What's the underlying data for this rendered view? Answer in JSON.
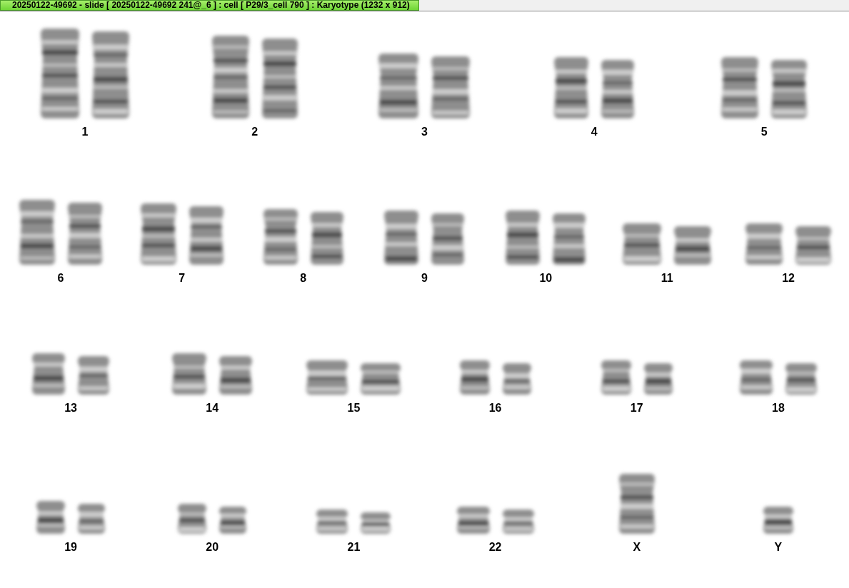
{
  "title_bar": {
    "title": "20250122-49692 - slide [ 20250122-49692 241@_6 ] : cell [ P29/3_cell 790 ] : Karyotype  (1232 x 912)"
  },
  "karyotype": {
    "rows": [
      [
        {
          "label": "1",
          "kind": "pair"
        },
        {
          "label": "2",
          "kind": "pair"
        },
        {
          "label": "3",
          "kind": "pair"
        },
        {
          "label": "4",
          "kind": "pair"
        },
        {
          "label": "5",
          "kind": "pair"
        }
      ],
      [
        {
          "label": "6",
          "kind": "pair"
        },
        {
          "label": "7",
          "kind": "pair"
        },
        {
          "label": "8",
          "kind": "pair"
        },
        {
          "label": "9",
          "kind": "pair"
        },
        {
          "label": "10",
          "kind": "pair"
        },
        {
          "label": "11",
          "kind": "pair"
        },
        {
          "label": "12",
          "kind": "pair"
        }
      ],
      [
        {
          "label": "13",
          "kind": "pair"
        },
        {
          "label": "14",
          "kind": "pair"
        },
        {
          "label": "15",
          "kind": "pair"
        },
        {
          "label": "16",
          "kind": "pair"
        },
        {
          "label": "17",
          "kind": "pair"
        },
        {
          "label": "18",
          "kind": "pair"
        }
      ],
      [
        {
          "label": "19",
          "kind": "pair"
        },
        {
          "label": "20",
          "kind": "pair"
        },
        {
          "label": "21",
          "kind": "pair"
        },
        {
          "label": "22",
          "kind": "pair"
        },
        {
          "label": "X",
          "kind": "single"
        },
        {
          "label": "Y",
          "kind": "single"
        }
      ]
    ]
  }
}
